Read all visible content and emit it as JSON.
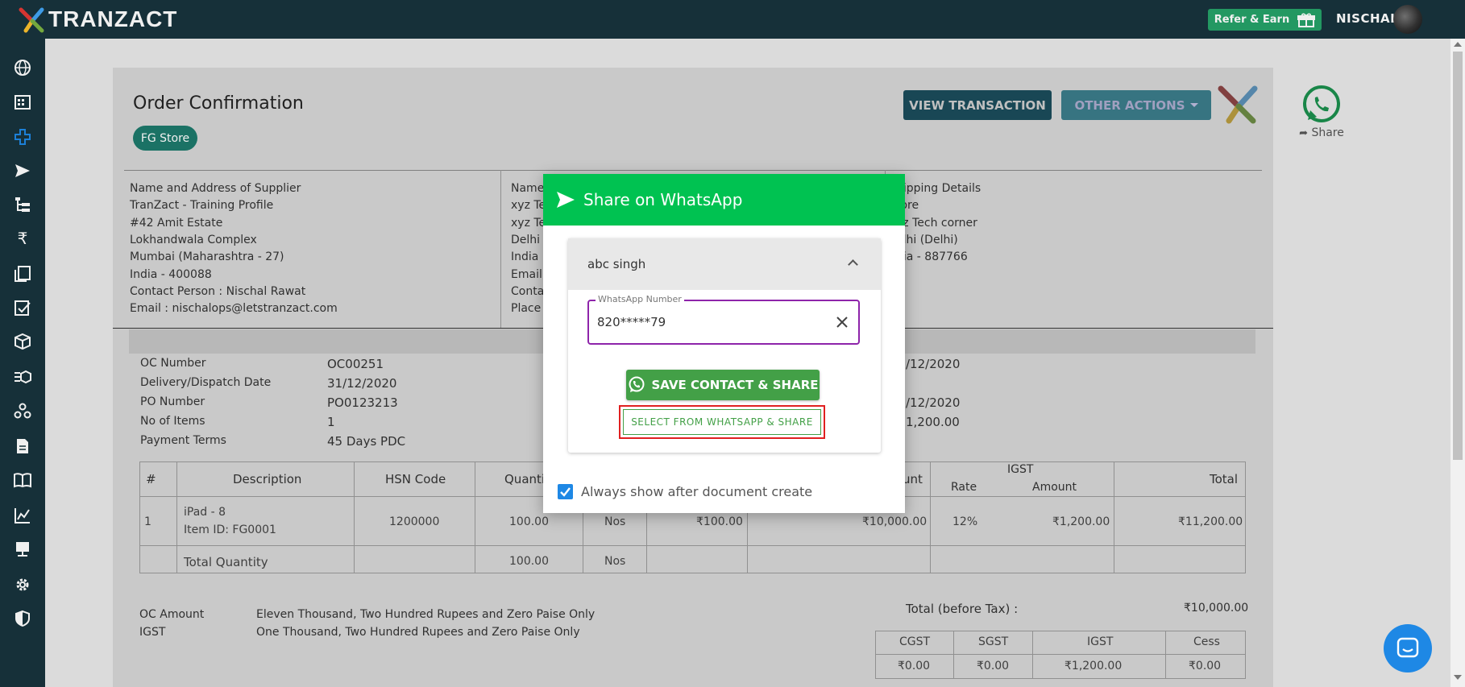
{
  "topbar": {
    "brand": "TRANZACT",
    "refer_label": "Refer & Earn",
    "user_name": "NISCHAL"
  },
  "sidebar": {
    "icons": [
      "globe-icon",
      "building-icon",
      "plus-cross-icon",
      "send-icon",
      "hierarchy-icon",
      "rupee-icon",
      "documents-icon",
      "checklist-icon",
      "box-icon",
      "list-box-icon",
      "network-icon",
      "file-icon",
      "book-icon",
      "chart-icon",
      "computer-icon",
      "gear-icon",
      "shield-icon"
    ]
  },
  "header": {
    "title": "Order Confirmation",
    "store_badge": "FG Store",
    "view_transaction": "VIEW TRANSACTION",
    "other_actions": "OTHER ACTIONS",
    "share_label": "Share"
  },
  "supplier": {
    "heading": "Name and Address of Supplier",
    "name": "TranZact - Training Profile",
    "lines": [
      "#42 Amit Estate",
      "Lokhandwala Complex",
      "Mumbai (Maharashtra - 27)",
      "India - 400088"
    ],
    "contact": "Contact Person : Nischal Rawat",
    "email": "Email : nischalops@letstranzact.com"
  },
  "buyer": {
    "lines": [
      "Name",
      "xyz Te",
      "xyz Te",
      "Delhi",
      "India",
      "Email",
      "Conta",
      "Place"
    ]
  },
  "shipping": {
    "heading": "hipping Details",
    "lines": [
      "tore",
      "yz Tech corner",
      "elhi (Delhi)",
      "dia - 887766"
    ]
  },
  "oc_info": {
    "labels": [
      "OC Number",
      "Delivery/Dispatch Date",
      "PO Number",
      "No of Items",
      "Payment Terms"
    ],
    "values": [
      "OC00251",
      "31/12/2020",
      "PO0123213",
      "1",
      "45 Days PDC"
    ],
    "right_values": [
      "/12/2020",
      "/12/2020",
      "1,200.00"
    ]
  },
  "items_table": {
    "headers": [
      "#",
      "Description",
      "HSN Code",
      "Quanti",
      "unt",
      "IGST",
      "Rate",
      "Amount",
      "Total"
    ],
    "row": {
      "index": "1",
      "description": "iPad - 8",
      "item_id": "Item ID: FG0001",
      "hsn": "1200000",
      "qty": "100.00",
      "unit": "Nos",
      "price": "₹100.00",
      "amount": "₹10,000.00",
      "rate": "12%",
      "igst_amount": "₹1,200.00",
      "total": "₹11,200.00"
    },
    "total_row": {
      "label": "Total Quantity",
      "qty": "100.00",
      "unit": "Nos"
    }
  },
  "summary": {
    "oc_amount_label": "OC Amount",
    "oc_amount_words": "Eleven Thousand, Two Hundred Rupees and Zero Paise Only",
    "igst_label": "IGST",
    "igst_words": "One Thousand, Two Hundred Rupees and Zero Paise Only",
    "total_before_tax_label": "Total (before Tax) :",
    "total_before_tax": "₹10,000.00",
    "tax_headers": [
      "CGST",
      "SGST",
      "IGST",
      "Cess"
    ],
    "tax_values": [
      "₹0.00",
      "₹0.00",
      "₹1,200.00",
      "₹0.00"
    ]
  },
  "modal": {
    "title": "Share on WhatsApp",
    "contact_name": "abc singh",
    "field_label": "WhatsApp Number",
    "field_value": "820*****79",
    "save_button": "SAVE CONTACT & SHARE",
    "select_button": "SELECT FROM WHATSAPP & SHARE",
    "checkbox_label": "Always show after document create",
    "checkbox_checked": true
  },
  "colors": {
    "nav_bg": "#18343d",
    "whatsapp_green": "#00c251",
    "button_green": "#43a047",
    "highlight_red": "#e02020",
    "field_purple": "#8e24aa"
  }
}
